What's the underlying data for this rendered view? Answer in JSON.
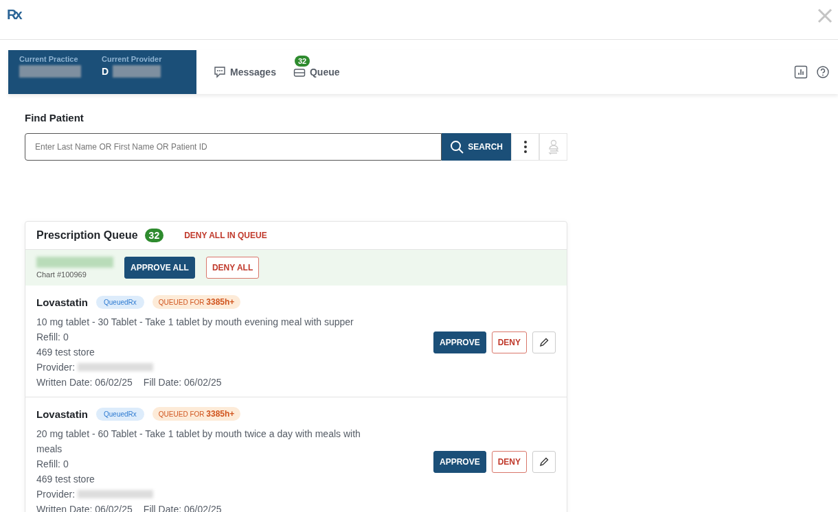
{
  "app": {
    "logo": "Rx"
  },
  "context": {
    "practice_label": "Current Practice",
    "provider_label": "Current Provider",
    "provider_initial": "D"
  },
  "nav": [
    {
      "kind": "messages",
      "label": "Messages",
      "selected": false
    },
    {
      "kind": "queue",
      "label": "Queue",
      "badge": "32",
      "selected": false
    }
  ],
  "find_patient": {
    "title": "Find Patient",
    "placeholder": "Enter Last Name OR First Name OR Patient ID",
    "search_button": "SEARCH"
  },
  "queue": {
    "title": "Prescription Queue",
    "count": "32",
    "deny_all_in_queue": "DENY ALL IN QUEUE",
    "patient": {
      "chart": "Chart #100969",
      "approve_all": "APPROVE ALL",
      "deny_all": "DENY ALL"
    },
    "items": [
      {
        "drug": "Lovastatin",
        "tag": "QueuedRx",
        "queued_prefix": "QUEUED FOR",
        "queued_time": "3385h+",
        "sig": "10 mg tablet - 30 Tablet - Take 1 tablet by mouth evening meal with supper",
        "refill": "Refill: 0",
        "store": "469 test store",
        "provider_label": "Provider:",
        "written": "Written Date: 06/02/25",
        "fill": "Fill Date: 06/02/25",
        "approve": "APPROVE",
        "deny": "DENY"
      },
      {
        "drug": "Lovastatin",
        "tag": "QueuedRx",
        "queued_prefix": "QUEUED FOR",
        "queued_time": "3385h+",
        "sig": "20 mg tablet - 60 Tablet - Take 1 tablet by mouth twice a day with meals with meals",
        "refill": "Refill: 0",
        "store": "469 test store",
        "provider_label": "Provider:",
        "written": "Written Date: 06/02/25",
        "fill": "Fill Date: 06/02/25",
        "approve": "APPROVE",
        "deny": "DENY"
      }
    ]
  }
}
